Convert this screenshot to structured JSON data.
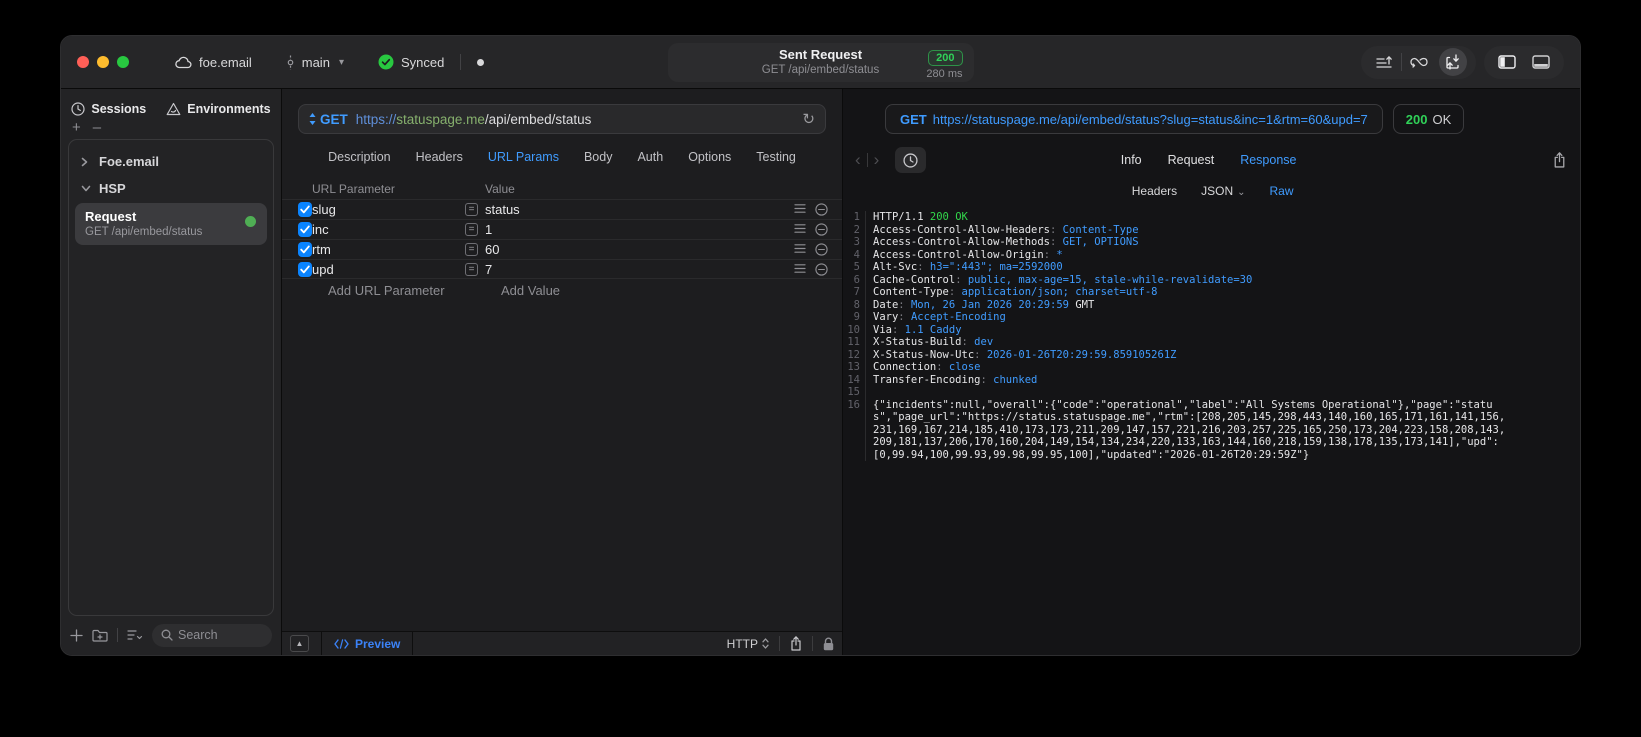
{
  "toolbar": {
    "project": "foe.email",
    "branch": "main",
    "sync_status": "Synced",
    "title": "Sent Request",
    "subtitle": "GET /api/embed/status",
    "status_code": "200",
    "duration": "280 ms"
  },
  "sidebar": {
    "tabs": [
      {
        "label": "Sessions"
      },
      {
        "label": "Environments"
      }
    ],
    "tree": [
      {
        "label": "Foe.email"
      },
      {
        "label": "HSP"
      }
    ],
    "selected_request": {
      "name": "Request",
      "method_path": "GET /api/embed/status"
    },
    "search_placeholder": "Search"
  },
  "request_editor": {
    "method": "GET",
    "url": {
      "protocol": "https://",
      "host": "statuspage.me",
      "path": "/api/embed/status"
    },
    "tabs": [
      "Description",
      "Headers",
      "URL Params",
      "Body",
      "Auth",
      "Options",
      "Testing"
    ],
    "active_tab": "URL Params",
    "params": {
      "columns": [
        "URL Parameter",
        "Value"
      ],
      "rows": [
        {
          "checked": true,
          "name": "slug",
          "value": "status"
        },
        {
          "checked": true,
          "name": "inc",
          "value": "1"
        },
        {
          "checked": true,
          "name": "rtm",
          "value": "60"
        },
        {
          "checked": true,
          "name": "upd",
          "value": "7"
        }
      ],
      "add_parameter_placeholder": "Add URL Parameter",
      "add_value_placeholder": "Add Value"
    },
    "footer": {
      "preview": "Preview",
      "protocol": "HTTP"
    }
  },
  "response_viewer": {
    "method": "GET",
    "url": "https://statuspage.me/api/embed/status?slug=status&inc=1&rtm=60&upd=7",
    "status_code": "200",
    "status_text": "OK",
    "tabs": [
      "Info",
      "Request",
      "Response"
    ],
    "active_tab": "Response",
    "subtabs": [
      {
        "label": "Headers"
      },
      {
        "label": "JSON",
        "dropdown": true
      },
      {
        "label": "Raw"
      }
    ],
    "active_subtab": "Raw",
    "lines": [
      {
        "n": "1",
        "seg": [
          [
            "w",
            "HTTP/1.1 "
          ],
          [
            "g",
            "200 OK"
          ]
        ]
      },
      {
        "n": "2",
        "seg": [
          [
            "w",
            "Access-Control-Allow-Headers"
          ],
          [
            "d",
            ": "
          ],
          [
            "b",
            "Content-Type"
          ]
        ]
      },
      {
        "n": "3",
        "seg": [
          [
            "w",
            "Access-Control-Allow-Methods"
          ],
          [
            "d",
            ": "
          ],
          [
            "b",
            "GET, OPTIONS"
          ]
        ]
      },
      {
        "n": "4",
        "seg": [
          [
            "w",
            "Access-Control-Allow-Origin"
          ],
          [
            "d",
            ": "
          ],
          [
            "b",
            "*"
          ]
        ]
      },
      {
        "n": "5",
        "seg": [
          [
            "w",
            "Alt-Svc"
          ],
          [
            "d",
            ": "
          ],
          [
            "b",
            "h3=\":443\"; ma=2592000"
          ]
        ]
      },
      {
        "n": "6",
        "seg": [
          [
            "w",
            "Cache-Control"
          ],
          [
            "d",
            ": "
          ],
          [
            "b",
            "public, max-age=15, stale-while-revalidate=30"
          ]
        ]
      },
      {
        "n": "7",
        "seg": [
          [
            "w",
            "Content-Type"
          ],
          [
            "d",
            ": "
          ],
          [
            "b",
            "application/json; charset=utf-8"
          ]
        ]
      },
      {
        "n": "8",
        "seg": [
          [
            "w",
            "Date"
          ],
          [
            "d",
            ": "
          ],
          [
            "b",
            "Mon, 26 Jan 2026 20:29:59"
          ],
          [
            "w",
            " GMT"
          ]
        ]
      },
      {
        "n": "9",
        "seg": [
          [
            "w",
            "Vary"
          ],
          [
            "d",
            ": "
          ],
          [
            "b",
            "Accept-Encoding"
          ]
        ]
      },
      {
        "n": "10",
        "seg": [
          [
            "w",
            "Via"
          ],
          [
            "d",
            ": "
          ],
          [
            "b",
            "1.1 Caddy"
          ]
        ]
      },
      {
        "n": "11",
        "seg": [
          [
            "w",
            "X-Status-Build"
          ],
          [
            "d",
            ": "
          ],
          [
            "b",
            "dev"
          ]
        ]
      },
      {
        "n": "12",
        "seg": [
          [
            "w",
            "X-Status-Now-Utc"
          ],
          [
            "d",
            ": "
          ],
          [
            "b",
            "2026-01-26T20:29:59.859105261Z"
          ]
        ]
      },
      {
        "n": "13",
        "seg": [
          [
            "w",
            "Connection"
          ],
          [
            "d",
            ": "
          ],
          [
            "b",
            "close"
          ]
        ]
      },
      {
        "n": "14",
        "seg": [
          [
            "w",
            "Transfer-Encoding"
          ],
          [
            "d",
            ": "
          ],
          [
            "b",
            "chunked"
          ]
        ]
      },
      {
        "n": "15",
        "seg": []
      },
      {
        "n": "16",
        "wrap": true,
        "seg": [
          [
            "w",
            "{\"incidents\":null,\"overall\":{\"code\":\"operational\",\"label\":\"All Systems Operational\"},\"page\":\"status\",\"page_url\":\"https://status.statuspage.me\",\"rtm\":[208,205,145,298,443,140,160,165,171,161,141,156,231,169,167,214,185,410,173,173,211,209,147,157,221,216,203,257,225,165,250,173,204,223,158,208,143,209,181,137,206,170,160,204,149,154,134,234,220,133,163,144,160,218,159,138,178,135,173,141],\"upd\":[0,99.94,100,99.93,99.98,99.95,100],\"updated\":\"2026-01-26T20:29:59Z\"}"
          ]
        ]
      }
    ]
  }
}
